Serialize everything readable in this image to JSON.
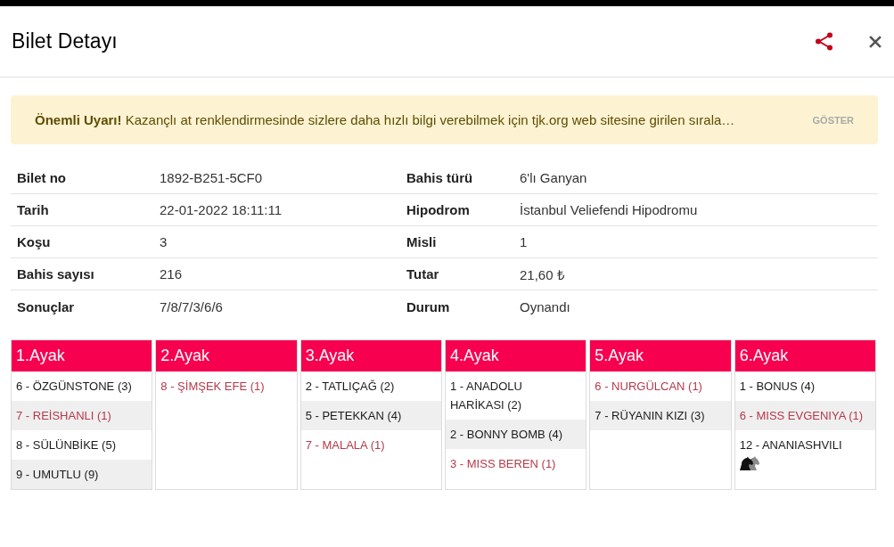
{
  "header": {
    "title": "Bilet Detayı"
  },
  "alert": {
    "text": "**Önemli Uyarı!** Kazançlı at renklendirmesinde sizlere daha hızlı bilgi verebilmek için tjk.org web sitesine girilen sırala…",
    "action": "GÖSTER"
  },
  "details": [
    {
      "left": {
        "label": "Bilet no",
        "value": "1892-B251-5CF0"
      },
      "right": {
        "label": "Bahis türü",
        "value": "6'lı Ganyan"
      }
    },
    {
      "left": {
        "label": "Tarih",
        "value": "22-01-2022 18:11:11"
      },
      "right": {
        "label": "Hipodrom",
        "value": "İstanbul Veliefendi Hipodromu"
      }
    },
    {
      "left": {
        "label": "Koşu",
        "value": "3"
      },
      "right": {
        "label": "Misli",
        "value": "1"
      }
    },
    {
      "left": {
        "label": "Bahis sayısı",
        "value": "216"
      },
      "right": {
        "label": "Tutar",
        "value": "21,60 ₺"
      }
    },
    {
      "left": {
        "label": "Sonuçlar",
        "value": "7/8/7/3/6/6"
      },
      "right": {
        "label": "Durum",
        "value": "Oynandı"
      }
    }
  ],
  "legs": [
    {
      "title": "1.Ayak",
      "horses": [
        {
          "label": "6 - ÖZGÜNSTONE (3)",
          "winner": false,
          "has_icon": false
        },
        {
          "label": "7 - REİSHANLI (1)",
          "winner": true,
          "has_icon": false
        },
        {
          "label": "8 - SÜLÜNBİKE (5)",
          "winner": false,
          "has_icon": false
        },
        {
          "label": "9 - UMUTLU (9)",
          "winner": false,
          "has_icon": false
        }
      ]
    },
    {
      "title": "2.Ayak",
      "horses": [
        {
          "label": "8 - ŞİMŞEK EFE (1)",
          "winner": true,
          "has_icon": false
        }
      ]
    },
    {
      "title": "3.Ayak",
      "horses": [
        {
          "label": "2 - TATLIÇAĞ (2)",
          "winner": false,
          "has_icon": false
        },
        {
          "label": "5 - PETEKKAN (4)",
          "winner": false,
          "has_icon": false
        },
        {
          "label": "7 - MALALA (1)",
          "winner": true,
          "has_icon": false
        }
      ]
    },
    {
      "title": "4.Ayak",
      "horses": [
        {
          "label": "1 - ANADOLU HARİKASI (2)",
          "winner": false,
          "has_icon": false
        },
        {
          "label": "2 - BONNY BOMB (4)",
          "winner": false,
          "has_icon": false
        },
        {
          "label": "3 - MISS BEREN (1)",
          "winner": true,
          "has_icon": false
        }
      ]
    },
    {
      "title": "5.Ayak",
      "horses": [
        {
          "label": "6 - NURGÜLCAN (1)",
          "winner": true,
          "has_icon": false
        },
        {
          "label": "7 - RÜYANIN KIZI (3)",
          "winner": false,
          "has_icon": false
        }
      ]
    },
    {
      "title": "6.Ayak",
      "horses": [
        {
          "label": "1 - BONUS (4)",
          "winner": false,
          "has_icon": false
        },
        {
          "label": "6 - MISS EVGENIYA (1)",
          "winner": true,
          "has_icon": false
        },
        {
          "label": "12 - ANANIASHVILI",
          "winner": false,
          "has_icon": true
        }
      ]
    }
  ]
}
